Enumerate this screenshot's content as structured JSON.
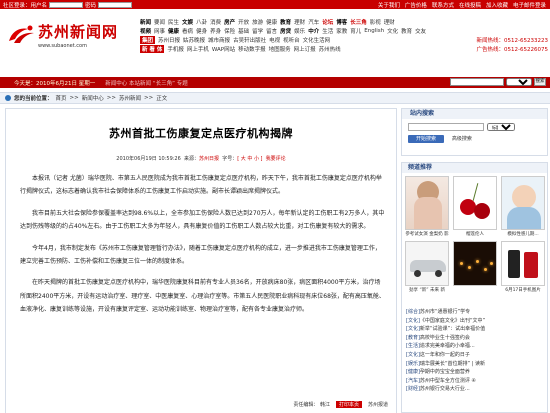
{
  "topbar": {
    "user_label": "社区登录：用户名",
    "pwd_label": "密码",
    "links": [
      "关于我们",
      "广告价格",
      "联系方式",
      "在线投稿",
      "加入收藏",
      "电子邮件登录"
    ]
  },
  "logo": {
    "title": "苏州新闻网",
    "url": "www.subaonet.com"
  },
  "nav": {
    "row1": [
      "新闻",
      "要闻",
      "民生",
      "文娱",
      "八卦",
      "消费",
      "房产",
      "开放",
      "旅游",
      "健康",
      "教育",
      "理财",
      "汽车",
      "论坛",
      "博客",
      "长三角",
      "影视",
      "理财"
    ],
    "row2": [
      "视频",
      "网事",
      "健康",
      "看病",
      "健身",
      "养身",
      "保险",
      "基础",
      "留学",
      "留言",
      "房贷",
      "娱乐",
      "中介",
      "生活",
      "家教",
      "育儿",
      "English",
      "文化",
      "教育",
      "交友",
      "空间"
    ],
    "row3_tag": "集团",
    "row3": [
      "苏州日报",
      "姑苏晚报",
      "城市商报",
      "古吴轩出版社",
      "电视",
      "视听台",
      "旅游",
      "广告",
      "文化生活网"
    ],
    "hotline1": "新闻热线：0512-65233223",
    "row4_tag": "新 看 体",
    "row4": [
      "手机报",
      "网上手机",
      "WAP网站",
      "移动数字报",
      "地图服务",
      "网上订报",
      "苏州热线"
    ],
    "hotline2": "广告热线：0512-65226075"
  },
  "datebar": {
    "date": "今天是：2010年6月21日 星期一",
    "ticker": "新闻中心  本站新闻 “长三角” 专题",
    "search_btn": "搜索"
  },
  "breadcrumb": {
    "label": "您的当前位置：",
    "items": [
      "首页",
      "新闻中心",
      "苏州新闻",
      "正文"
    ]
  },
  "article": {
    "title": "苏州首批工伤康复定点医疗机构揭牌",
    "date": "2010年06月19日  10:59:26",
    "source_label": "来源：",
    "source": "苏州日报",
    "size_label": "字号：",
    "size_opts": "[ 大  中  小 ]",
    "comment": "我要评论",
    "paras": [
      "本报讯（记者 尤菌）瑞华医院、市第五人民医院成为我市首批工伤康复定点医疗机构，昨天下午，我市首批工伤康复定点医疗机构举行揭牌仪式，这标志着确认我市社会保障体系的工伤康复工作启动实施。副市长谭颖出席揭牌仪式。",
      "我市目前五大社会保险参保覆盖率达到98.6%以上，全市参加工伤保险人数已达到270万人，每年新认定的工伤职工有2万多人，其中达到伤残等级的约占40%左右。由于工伤职工大多为年轻人，具有康复价值的工伤职工人数占较大比重，对工伤康复有较大的需求。",
      "今年4月，我市制定发布《苏州市工伤康复管理暂行办法》，随着工伤康复定点医疗机构的成立，进一步推进我市工伤康复管理工作，建立完善工伤预防、工伤补偿和工伤康复三位一体的制度体系。",
      "在昨天揭牌的首批工伤康复定点医疗机构中，瑞华医院康复科目前有专业人员36名，开放病床80张，病区面积4000平方米，治疗场所面积2400平方米，开设有运动治疗室、理疗室、中医康复室、心理治疗室等。市第五人民医院职业病科现有床位68张，配有高压氧舱、血液净化、康复训练等设施，开设有康复评定室、运动功能训练室、物理治疗室等，配有各专业康复治疗师。"
    ],
    "footer_editor": "责任编辑：  韩江",
    "footer_btn": "打印本页",
    "footer_right": "苏州报道"
  },
  "sidebar": {
    "search_title": "站内搜索",
    "search_select": "标题",
    "search_btn": "开始搜索",
    "adv": "高级搜索",
    "chan_title": "频道推荐",
    "thumbs": [
      {
        "cap": "参考试女演 金梨奶 影"
      },
      {
        "cap": "榴莲伦人"
      },
      {
        "cap": "模拟性感儿期..."
      },
      {
        "cap": "劲享 “新” 未来 新"
      },
      {
        "cap": ""
      },
      {
        "cap": "6月17日手机图片"
      }
    ],
    "list": [
      [
        "[综合]",
        "苏州市“通惠银行”学专"
      ],
      [
        "[文化]",
        "《中国家庭文化》出刊“文中”"
      ],
      [
        "[文化]",
        "新举“试验课”：试出幸福价值"
      ],
      [
        "[教育]",
        "高校毕业生十强签约会"
      ],
      [
        "[生活]",
        "追求完美幸福的小幸福..."
      ],
      [
        "[文化]",
        "这一年和你一起的日子"
      ],
      [
        "[娱乐]",
        "瑞华展美长“首位期排” | 读新"
      ],
      [
        "[健康]",
        "孕期中药宝宝全面营养"
      ],
      [
        "[汽车]",
        "苏州中型车全方位测评 ④"
      ],
      [
        "[财经]",
        "苏州银行交易大行业..."
      ]
    ]
  }
}
